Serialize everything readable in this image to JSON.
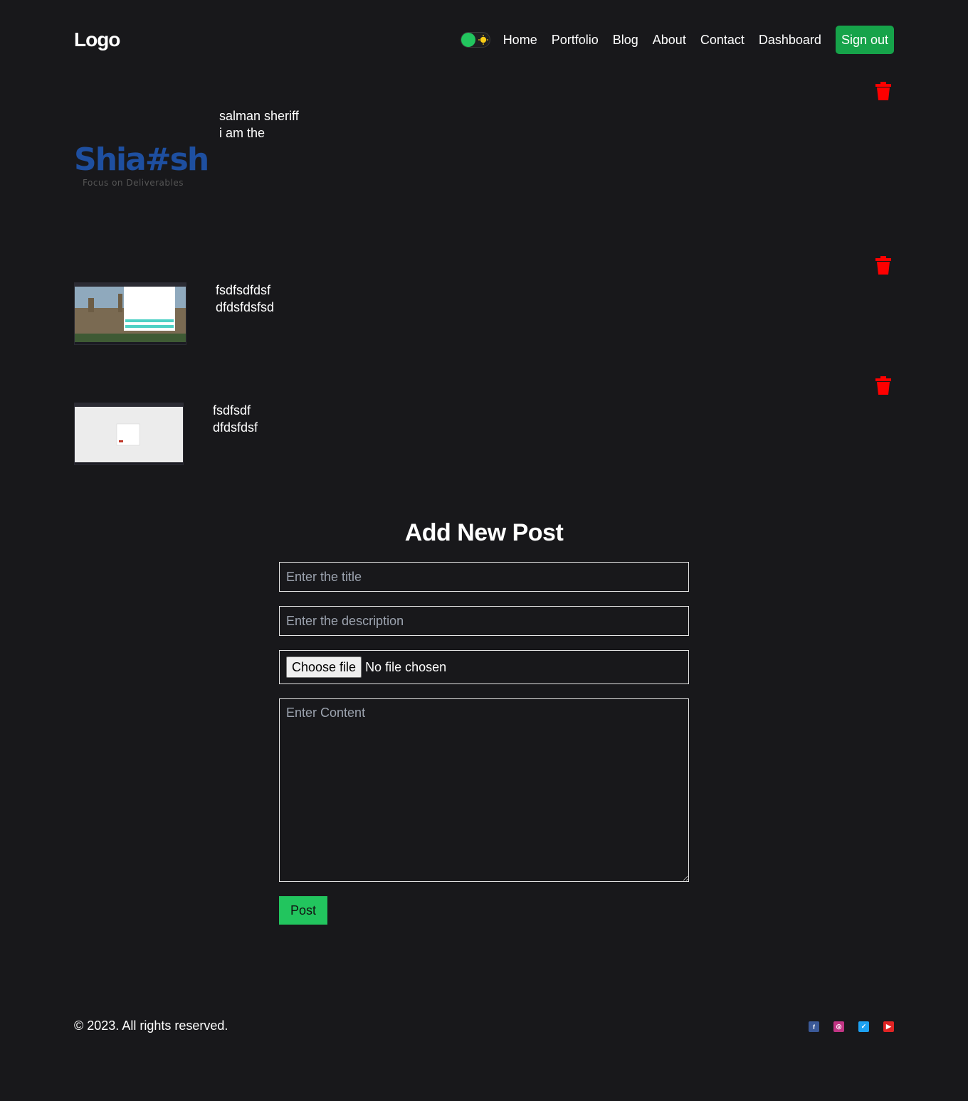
{
  "header": {
    "logo": "Logo",
    "nav": [
      "Home",
      "Portfolio",
      "Blog",
      "About",
      "Contact",
      "Dashboard"
    ],
    "signout_label": "Sign out",
    "theme_toggle_on": true
  },
  "posts": [
    {
      "title": "salman sheriff",
      "description": "i am the",
      "image": "shiash-logo-image",
      "logo_word": "Shia#sh",
      "logo_tagline": "Focus on Deliverables"
    },
    {
      "title": "fsdfsdfdsf",
      "description": "dfdsfdsfsd",
      "image": "college-screenshot-image"
    },
    {
      "title": "fsdfsdf",
      "description": "dfdsfdsf",
      "image": "login-screenshot-image"
    }
  ],
  "form": {
    "heading": "Add New Post",
    "title_placeholder": "Enter the title",
    "description_placeholder": "Enter the description",
    "file_button": "Choose file",
    "file_status": "No file chosen",
    "content_placeholder": "Enter Content",
    "submit_label": "Post"
  },
  "footer": {
    "copyright": "© 2023. All rights reserved.",
    "socials": [
      {
        "icon": "facebook-icon",
        "color": "#3b5998"
      },
      {
        "icon": "instagram-icon",
        "color": "#c13584"
      },
      {
        "icon": "twitter-icon",
        "color": "#1da1f2"
      },
      {
        "icon": "youtube-icon",
        "color": "#e02424"
      }
    ]
  },
  "colors": {
    "background": "#18181b",
    "accent": "#22c55e",
    "signout": "#16a34a",
    "delete": "#ff0000"
  }
}
